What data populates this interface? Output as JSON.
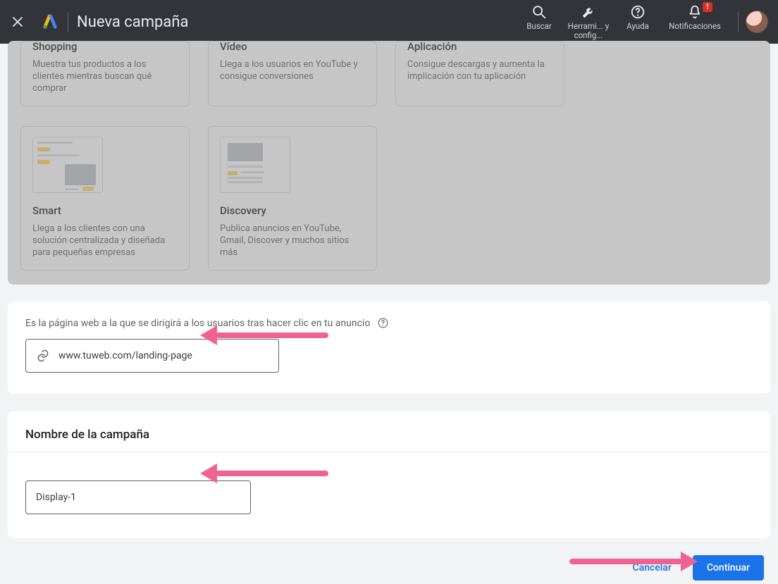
{
  "header": {
    "title": "Nueva campaña",
    "actions": {
      "search": "Buscar",
      "tools": "Herrami... y config...",
      "help": "Ayuda",
      "notifications": "Notificaciones",
      "notif_badge": "!"
    }
  },
  "cards": {
    "row1": [
      {
        "title": "Shopping",
        "desc": "Muestra tus productos a los clientes mientras buscan qué comprar"
      },
      {
        "title": "Vídeo",
        "desc": "Llega a los usuarios en YouTube y consigue conversiones"
      },
      {
        "title": "Aplicación",
        "desc": "Consigue descargas y aumenta la implicación con tu aplicación"
      }
    ],
    "row2": [
      {
        "title": "Smart",
        "desc": "Llega a los clientes con una solución centralizada y diseñada para pequeñas empresas"
      },
      {
        "title": "Discovery",
        "desc": "Publica anuncios en YouTube, Gmail, Discover y muchos sitios más"
      }
    ]
  },
  "landing": {
    "help_text": "Es la página web a la que se dirigirá a los usuarios tras hacer clic en tu anuncio",
    "url_value": "www.tuweb.com/landing-page"
  },
  "campaign_name": {
    "heading": "Nombre de la campaña",
    "value": "Display-1"
  },
  "footer": {
    "cancel": "Cancelar",
    "continue": "Continuar"
  }
}
